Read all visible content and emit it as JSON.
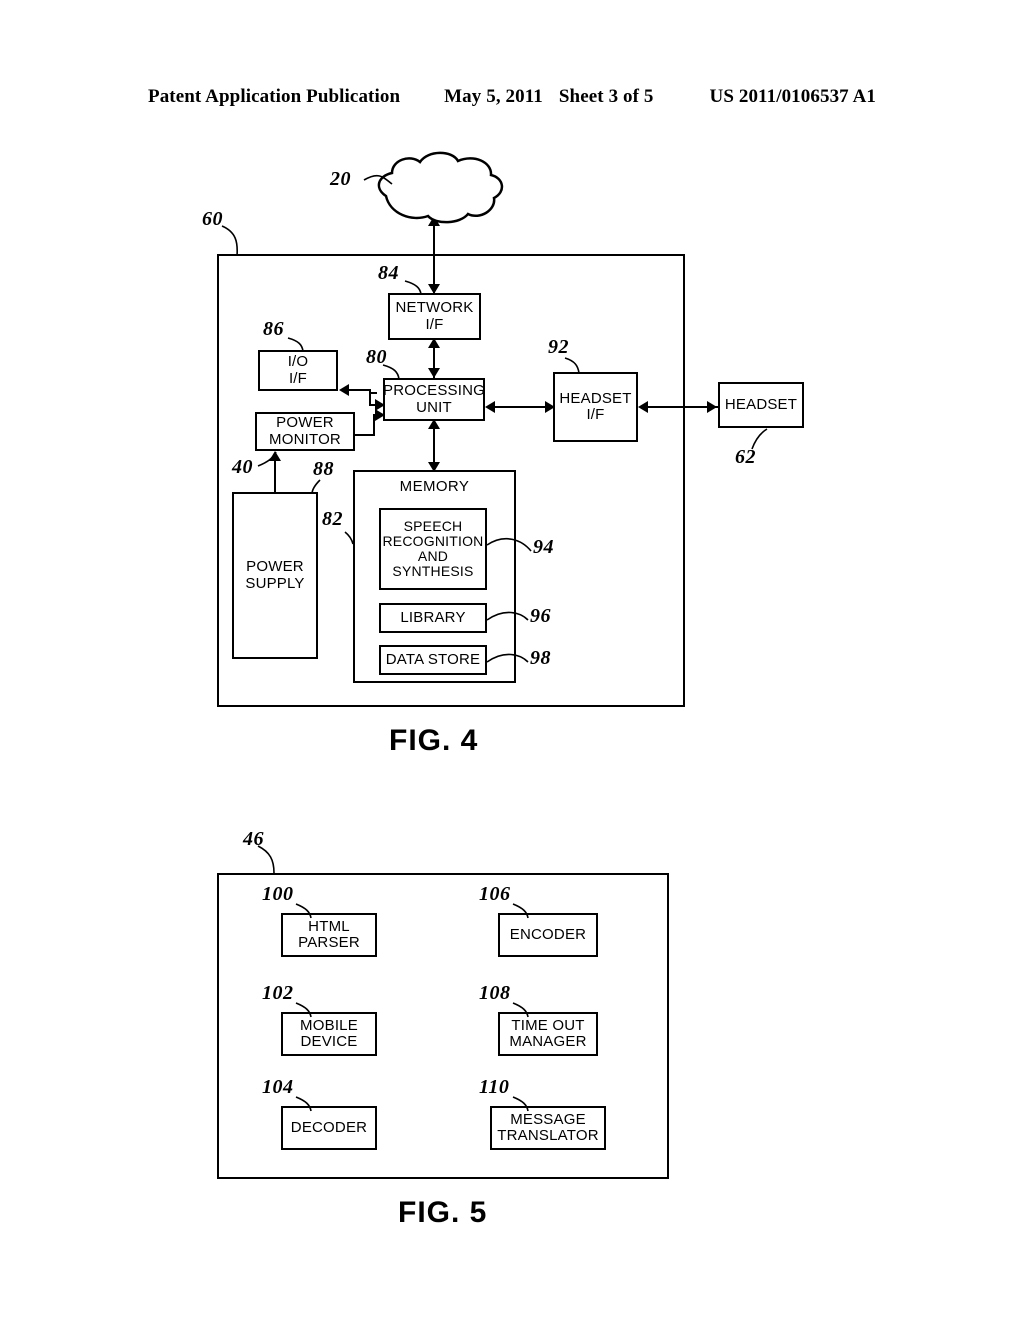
{
  "header": {
    "publication": "Patent Application Publication",
    "date": "May 5, 2011",
    "sheet": "Sheet 3 of 5",
    "number": "US 2011/0106537 A1"
  },
  "figures": [
    {
      "caption": "FIG. 4",
      "container_ref": "60",
      "nodes": {
        "network": {
          "label": "NETWORK",
          "ref": "20"
        },
        "network_if": {
          "label": "NETWORK\nI/F",
          "ref": "84"
        },
        "io_if": {
          "label": "I/O\nI/F",
          "ref": "86"
        },
        "processing_unit": {
          "label": "PROCESSING\nUNIT",
          "ref": "80"
        },
        "power_monitor": {
          "label": "POWER\nMONITOR",
          "ref": "88"
        },
        "power_supply": {
          "label": "POWER\nSUPPLY",
          "ref": "40"
        },
        "headset_if": {
          "label": "HEADSET\nI/F",
          "ref": "92"
        },
        "headset": {
          "label": "HEADSET",
          "ref": "62"
        },
        "memory": {
          "label": "MEMORY",
          "ref": "82"
        },
        "speech": {
          "label": "SPEECH\nRECOGNITION\nAND\nSYNTHESIS",
          "ref": "94"
        },
        "library": {
          "label": "LIBRARY",
          "ref": "96"
        },
        "data_store": {
          "label": "DATA STORE",
          "ref": "98"
        }
      }
    },
    {
      "caption": "FIG. 5",
      "container_ref": "46",
      "nodes": {
        "html_parser": {
          "label": "HTML\nPARSER",
          "ref": "100"
        },
        "mobile_device": {
          "label": "MOBILE\nDEVICE",
          "ref": "102"
        },
        "decoder": {
          "label": "DECODER",
          "ref": "104"
        },
        "encoder": {
          "label": "ENCODER",
          "ref": "106"
        },
        "time_out_manager": {
          "label": "TIME OUT\nMANAGER",
          "ref": "108"
        },
        "message_translator": {
          "label": "MESSAGE\nTRANSLATOR",
          "ref": "110"
        }
      }
    }
  ],
  "colors": {
    "ink": "#000000",
    "paper": "#ffffff"
  }
}
